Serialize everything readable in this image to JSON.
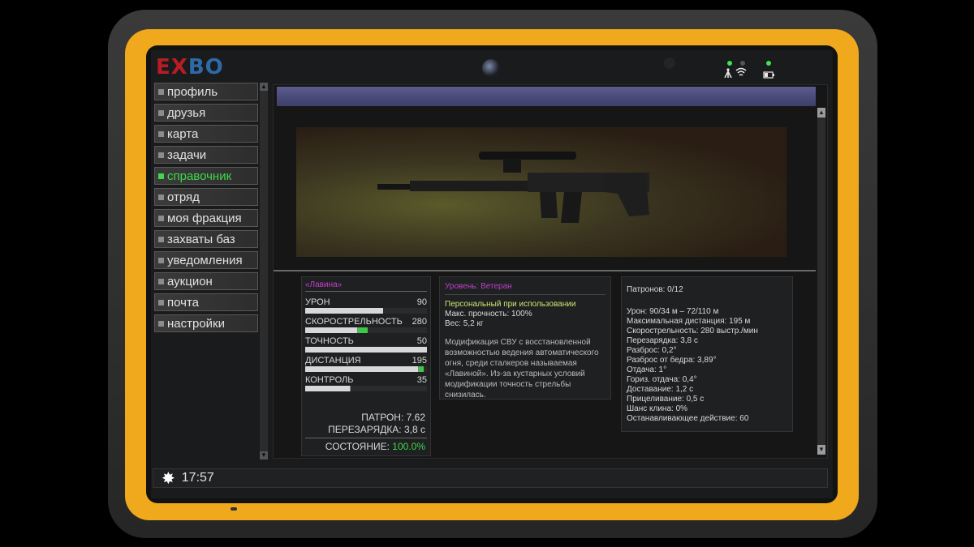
{
  "logo": {
    "part1": "EX",
    "part2": "BO"
  },
  "menu": [
    {
      "label": "профиль",
      "active": false
    },
    {
      "label": "друзья",
      "active": false
    },
    {
      "label": "карта",
      "active": false
    },
    {
      "label": "задачи",
      "active": false
    },
    {
      "label": "справочник",
      "active": true
    },
    {
      "label": "отряд",
      "active": false
    },
    {
      "label": "моя фракция",
      "active": false
    },
    {
      "label": "захваты баз",
      "active": false
    },
    {
      "label": "уведомления",
      "active": false
    },
    {
      "label": "аукцион",
      "active": false
    },
    {
      "label": "почта",
      "active": false
    },
    {
      "label": "настройки",
      "active": false
    }
  ],
  "weapon": {
    "name": "«Лавина»",
    "stats": [
      {
        "label": "УРОН",
        "value": "90",
        "percent": 64,
        "bonus": 0
      },
      {
        "label": "СКОРОСТРЕЛЬНОСТЬ",
        "value": "280",
        "percent": 43,
        "bonus": 8
      },
      {
        "label": "ТОЧНОСТЬ",
        "value": "50",
        "percent": 100,
        "bonus": 0
      },
      {
        "label": "ДИСТАНЦИЯ",
        "value": "195",
        "percent": 93,
        "bonus": 4
      },
      {
        "label": "КОНТРОЛЬ",
        "value": "35",
        "percent": 37,
        "bonus": 0
      }
    ],
    "ammo": "ПАТРОН: 7.62",
    "reload": "ПЕРЕЗАРЯДКА: 3,8 с",
    "condition_label": "СОСТОЯНИЕ: ",
    "condition_value": "100.0%"
  },
  "info": {
    "level": "Уровень: Ветеран",
    "personal": "Персональный при использовании",
    "durability": "Макс. прочность: 100%",
    "weight": "Вес: 5,2 кг",
    "description": "Модификация СВУ с восстановленной возможностью ведения автоматического огня, среди сталкеров называемая «Лавиной». Из-за кустарных условий модификации точность стрельбы снизилась."
  },
  "details": {
    "ammo_count": "Патронов: 0/12",
    "lines": [
      "Урон: 90/34 м – 72/110 м",
      "Максимальная дистанция: 195 м",
      "Скорострельность: 280 выстр./мин",
      "Перезарядка: 3,8 с",
      "Разброс: 0,2°",
      "Разброс от бедра: 3,89°",
      "Отдача: 1°",
      "Гориз. отдача: 0,4°",
      "Доставание: 1,2 с",
      "Прицеливание: 0,5 с",
      "Шанс клина: 0%",
      "Останавливающее действие: 60"
    ]
  },
  "taskbar": {
    "clock": "17:57"
  },
  "colors": {
    "frame": "#f0a81c",
    "accent_green": "#3fd84a",
    "accent_magenta": "#c040c8"
  }
}
